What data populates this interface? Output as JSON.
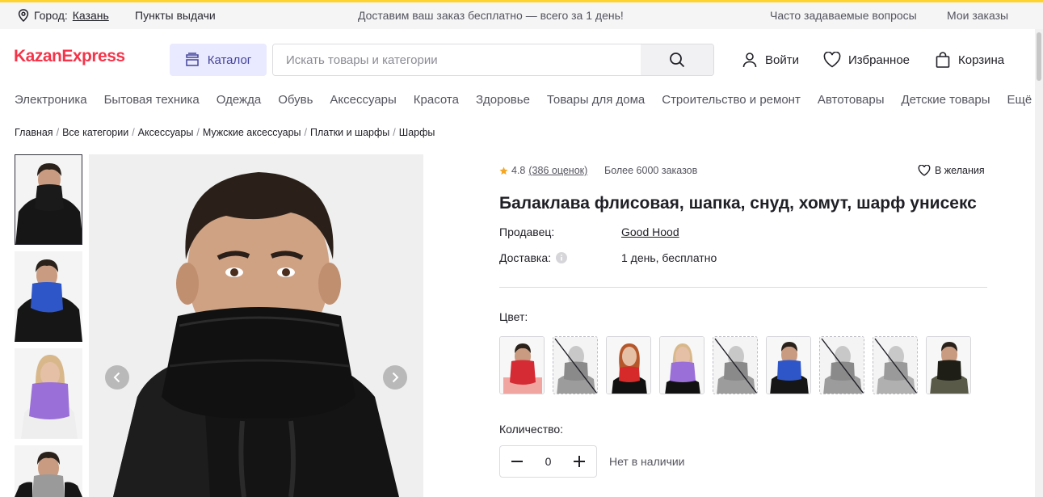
{
  "topbar": {
    "city_label": "Город:",
    "city_value": "Казань",
    "pickup": "Пункты выдачи",
    "promo": "Доставим ваш заказ бесплатно — всего за 1 день!",
    "faq": "Часто задаваемые вопросы",
    "orders": "Мои заказы"
  },
  "header": {
    "logo": "KazanExpress",
    "catalog": "Каталог",
    "search_placeholder": "Искать товары и категории",
    "login": "Войти",
    "favorites": "Избранное",
    "cart": "Корзина"
  },
  "categories": [
    "Электроника",
    "Бытовая техника",
    "Одежда",
    "Обувь",
    "Аксессуары",
    "Красота",
    "Здоровье",
    "Товары для дома",
    "Строительство и ремонт",
    "Автотовары",
    "Детские товары"
  ],
  "categories_more": "Ещё",
  "breadcrumbs": [
    "Главная",
    "Все категории",
    "Аксессуары",
    "Мужские аксессуары",
    "Платки и шарфы",
    "Шарфы"
  ],
  "product": {
    "rating": "4.8",
    "reviews": "(386 оценок)",
    "orders": "Более 6000 заказов",
    "wishlist": "В желания",
    "title": "Балаклава флисовая, шапка, снуд, хомут, шарф унисекс",
    "seller_label": "Продавец:",
    "seller": "Good Hood",
    "delivery_label": "Доставка:",
    "delivery": "1 день, бесплатно",
    "color_label": "Цвет:",
    "quantity_label": "Количество:",
    "quantity": "0",
    "stock": "Нет в наличии"
  },
  "colors": {
    "star": "#f5a623",
    "brand_red": "#f5344a",
    "catalog_bg": "#e9e9ff",
    "swatches": [
      "#d42b35",
      "#8a8a8a",
      "#d62a2a",
      "#9a6fd8",
      "#8a8a8a",
      "#2f56c8",
      "#8a8a8a",
      "#8a8a8a",
      "#3b3a2e"
    ]
  },
  "swatch_available": [
    true,
    false,
    true,
    true,
    false,
    true,
    false,
    false,
    true
  ]
}
